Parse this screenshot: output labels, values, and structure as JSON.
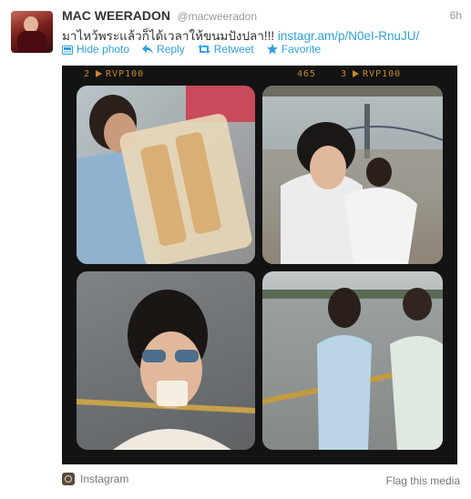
{
  "tweet": {
    "author_name": "MAC WEERADON",
    "author_handle": "@macweeradon",
    "timestamp": "6h",
    "text": "มาไหว้พระแล้วก็ได้เวลาให้ขนมปังปลา!!! ",
    "link": "instagr.am/p/N0eI-RnuJU/"
  },
  "actions": [
    {
      "label": "Hide photo",
      "icon": "photo-icon"
    },
    {
      "label": "Reply",
      "icon": "reply-icon"
    },
    {
      "label": "Retweet",
      "icon": "retweet-icon"
    },
    {
      "label": "Favorite",
      "icon": "star-icon"
    }
  ],
  "film_strip": {
    "left_frame": "2",
    "left_stock": "RVP100",
    "middle_number": "465",
    "right_frame": "3",
    "right_stock": "RVP100"
  },
  "footer": {
    "source": "Instagram",
    "flag": "Flag this media"
  },
  "colors": {
    "link": "#2fa0de",
    "frame": "#131313",
    "film_text": "#c8862e"
  }
}
